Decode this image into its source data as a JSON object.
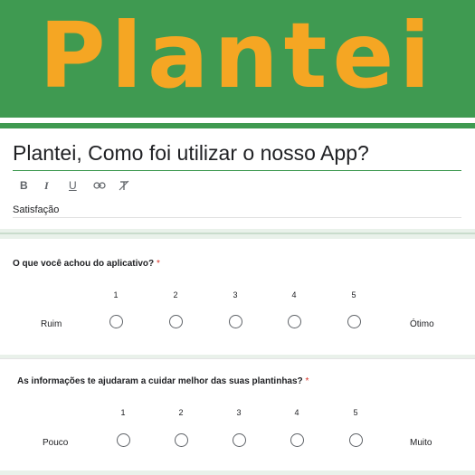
{
  "header": {
    "logo_text": "Plantei"
  },
  "form": {
    "title": "Plantei, Como foi utilizar o nosso App?",
    "toolbar": {
      "bold": "B",
      "italic": "I",
      "underline": "U",
      "link": "⊂⊃",
      "clear": "T̸"
    },
    "description": "Satisfação"
  },
  "questions": [
    {
      "title": "O que você achou do aplicativo?",
      "required_mark": "*",
      "scale": [
        "1",
        "2",
        "3",
        "4",
        "5"
      ],
      "low_label": "Ruim",
      "high_label": "Ótimo"
    },
    {
      "title": "As informações te ajudaram a cuidar melhor das suas plantinhas?",
      "required_mark": "*",
      "scale": [
        "1",
        "2",
        "3",
        "4",
        "5"
      ],
      "low_label": "Pouco",
      "high_label": "Muito"
    }
  ],
  "colors": {
    "brand_green": "#3f9a51",
    "logo_orange": "#f5a623",
    "required_red": "#d93025"
  },
  "icons": {
    "bold": "bold-icon",
    "italic": "italic-icon",
    "underline": "underline-icon",
    "link": "link-icon",
    "clear_format": "clear-format-icon"
  }
}
